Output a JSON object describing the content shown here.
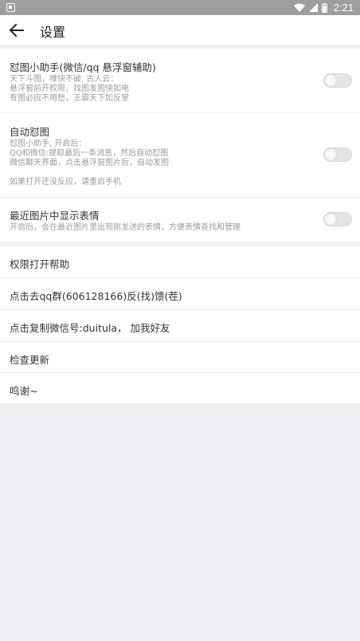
{
  "status_bar": {
    "time": "2:21"
  },
  "app_bar": {
    "title": "设置"
  },
  "settings": [
    {
      "title": "怼图小助手(微信/qq 悬浮窗辅助)",
      "description": [
        "天下斗图，唯快不破, 古人云：",
        "悬浮窗前开权限，找图发图快如电",
        "有图必应不用愁，王霸天下如反掌"
      ],
      "enabled": false
    },
    {
      "title": "自动怼图",
      "description": [
        "怼图小助手, 开启后：",
        "QQ和微信:提取最后一条消息，然后自动怼图",
        "微信聊天界面，点击悬浮窗图片后，自动发图",
        "",
        "如果打开还没反应，请重启手机"
      ],
      "enabled": false
    },
    {
      "title": "最近图片中显示表情",
      "description": [
        "开启后，会在最近图片里出现刚发送的表情，方便表情查找和管理"
      ],
      "enabled": false
    }
  ],
  "actions": [
    {
      "label": "权限打开帮助"
    },
    {
      "label": "点击去qq群(606128166)反(找)馈(茬)"
    },
    {
      "label": "点击复制微信号:duitula，  加我好友"
    },
    {
      "label": "检查更新"
    },
    {
      "label": "鸣谢~"
    }
  ],
  "colors": {
    "background": "#efeff1",
    "status_bar": "#9e9e9e",
    "toggle_off": "#e3e3e3"
  }
}
